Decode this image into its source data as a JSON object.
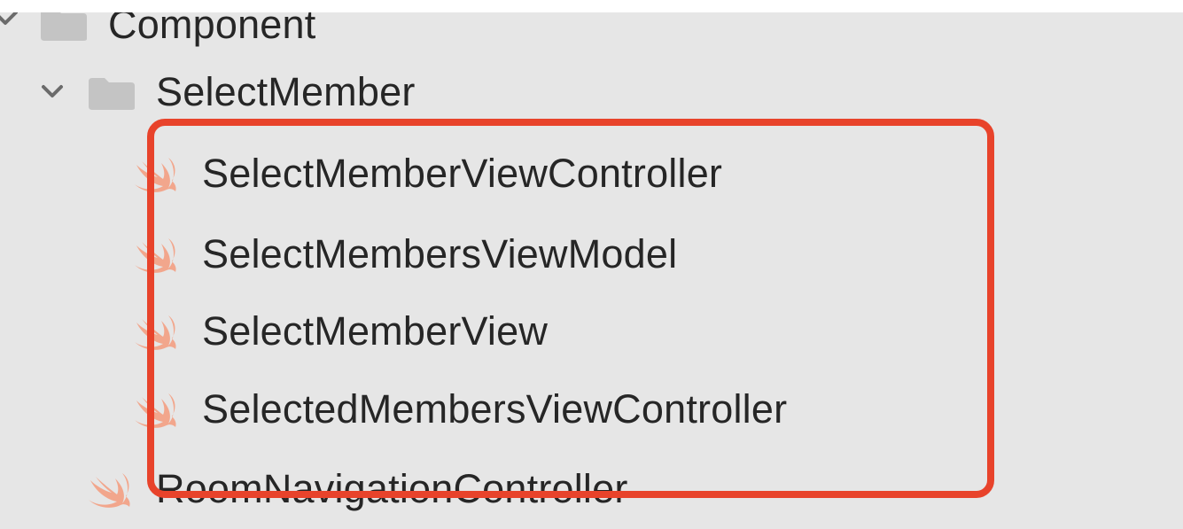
{
  "colors": {
    "navigator_background": "#e6e6e6",
    "text": "#262626",
    "highlight": "#e8432b",
    "swift_icon": "#f2a68c",
    "folder_icon": "#c4c4c4"
  },
  "navigator": {
    "items": [
      {
        "label": "Component",
        "icon": "folder-icon",
        "disclosure": "chevron-down-icon"
      },
      {
        "label": "SelectMember",
        "icon": "folder-icon",
        "disclosure": "chevron-down-icon"
      },
      {
        "label": "SelectMemberViewController",
        "icon": "swift-file-icon"
      },
      {
        "label": "SelectMembersViewModel",
        "icon": "swift-file-icon"
      },
      {
        "label": "SelectMemberView",
        "icon": "swift-file-icon"
      },
      {
        "label": "SelectedMembersViewController",
        "icon": "swift-file-icon"
      },
      {
        "label": "RoomNavigationController",
        "icon": "swift-file-icon"
      }
    ]
  }
}
